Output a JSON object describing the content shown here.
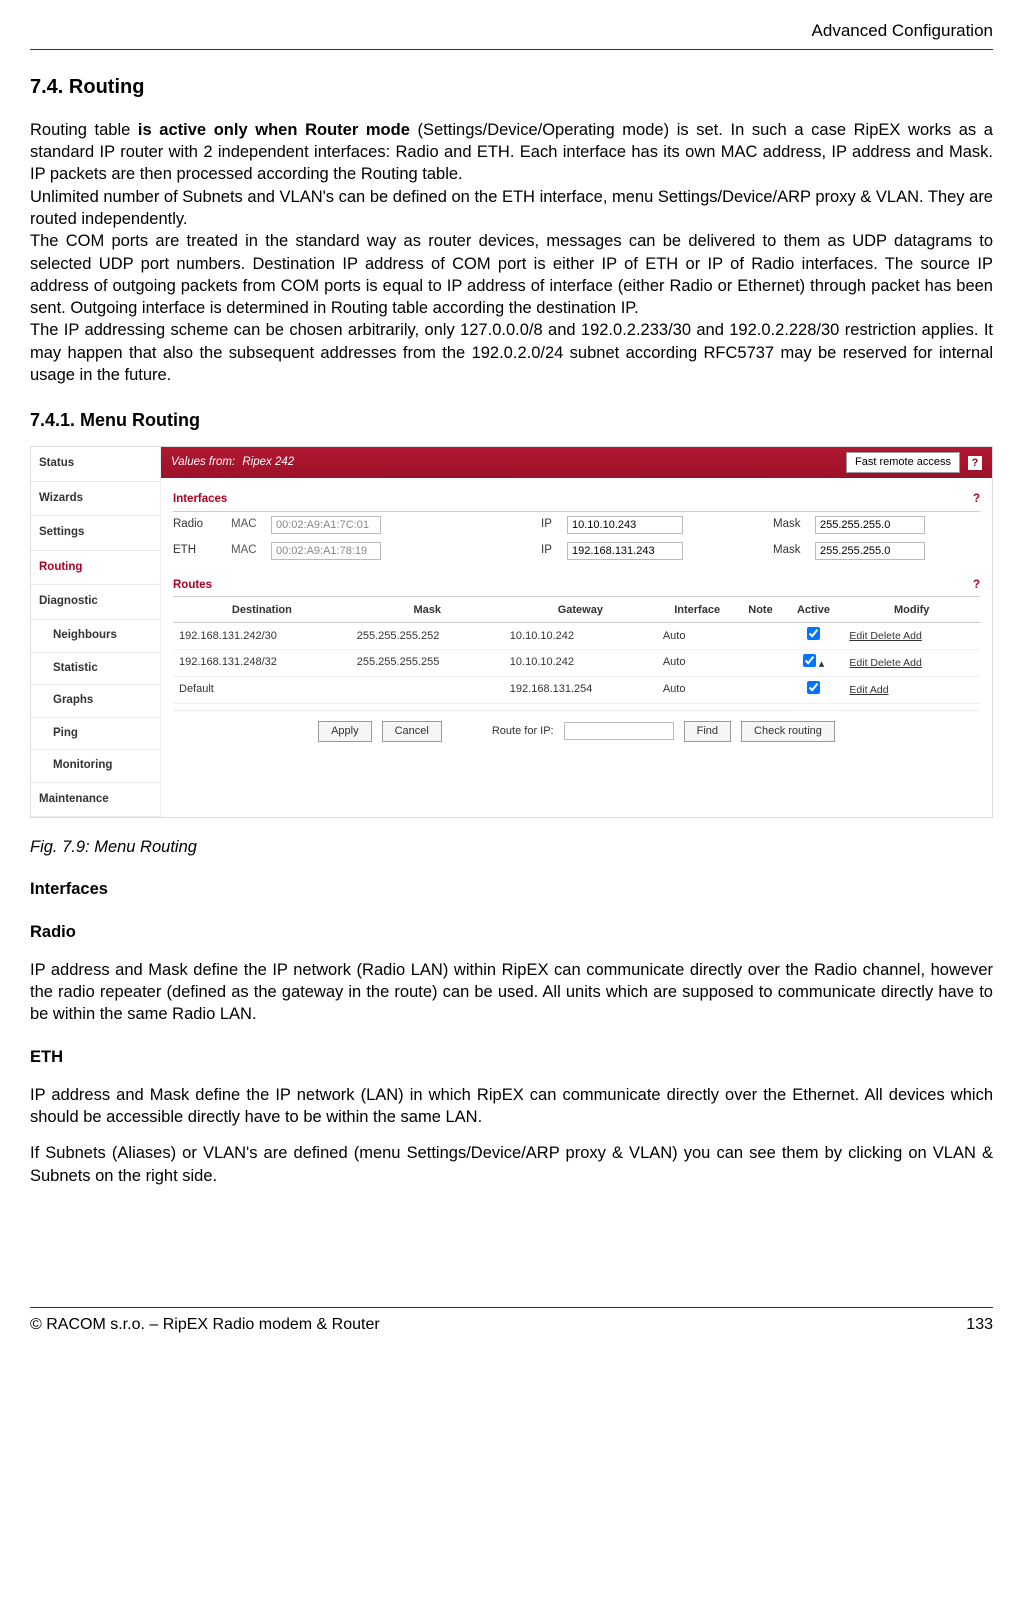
{
  "header": {
    "right": "Advanced Configuration"
  },
  "section": {
    "title": "7.4. Routing",
    "p1a": "Routing table ",
    "p1b": "is active only when Router mode",
    "p1c": " (Settings/Device/Operating mode) is set. In such a case RipEX works as a standard IP router with 2 independent interfaces: Radio and ETH. Each interface has its own MAC address, IP address and Mask. IP packets are then processed according the Routing table.",
    "p2": "Unlimited number of Subnets and VLAN's can be defined on the ETH interface, menu Settings/Device/ARP proxy & VLAN. They are routed independently.",
    "p3": "The COM ports are treated in the standard way as router devices, messages can be delivered to them as UDP datagrams to selected UDP port numbers. Destination IP address of COM port is either IP of ETH or IP of Radio interfaces. The source IP address of outgoing packets from COM ports is equal to IP address of interface (either Radio or Ethernet) through packet has been sent. Outgoing interface is determined in Routing table according the destination IP.",
    "p4": "The IP addressing scheme can be chosen arbitrarily, only 127.0.0.0/8 and 192.0.2.233/30 and 192.0.2.228/30 restriction applies. It may happen that also the subsequent addresses from the 192.0.2.0/24 subnet according RFC5737 may be reserved for internal usage in the future.",
    "subTitle": "7.4.1. Menu Routing"
  },
  "screenshot": {
    "sidebar": {
      "items": [
        "Status",
        "Wizards",
        "Settings",
        "Routing",
        "Diagnostic"
      ],
      "subitems": [
        "Neighbours",
        "Statistic",
        "Graphs",
        "Ping",
        "Monitoring"
      ],
      "last": "Maintenance",
      "activeIndex": 3
    },
    "topbar": {
      "label": "Values from:",
      "device": "Ripex 242",
      "fast": "Fast remote access",
      "help": "?"
    },
    "interfaces": {
      "title": "Interfaces",
      "help": "?",
      "rows": [
        {
          "name": "Radio",
          "macLabel": "MAC",
          "mac": "00:02:A9:A1:7C:01",
          "ipLabel": "IP",
          "ip": "10.10.10.243",
          "maskLabel": "Mask",
          "mask": "255.255.255.0"
        },
        {
          "name": "ETH",
          "macLabel": "MAC",
          "mac": "00:02:A9:A1:78:19",
          "ipLabel": "IP",
          "ip": "192.168.131.243",
          "maskLabel": "Mask",
          "mask": "255.255.255.0"
        }
      ]
    },
    "routes": {
      "title": "Routes",
      "help": "?",
      "headers": [
        "Destination",
        "Mask",
        "Gateway",
        "Interface",
        "Note",
        "Active",
        "Modify"
      ],
      "rows": [
        {
          "dest": "192.168.131.242/30",
          "mask": "255.255.255.252",
          "gw": "10.10.10.242",
          "iface": "Auto",
          "note": "",
          "active": true,
          "arrow": "",
          "mod": "Edit Delete Add"
        },
        {
          "dest": "192.168.131.248/32",
          "mask": "255.255.255.255",
          "gw": "10.10.10.242",
          "iface": "Auto",
          "note": "",
          "active": true,
          "arrow": "▴",
          "mod": "Edit Delete Add"
        },
        {
          "dest": "Default",
          "mask": "",
          "gw": "192.168.131.254",
          "iface": "Auto",
          "note": "",
          "active": true,
          "arrow": "",
          "mod": "Edit          Add"
        }
      ]
    },
    "bottom": {
      "apply": "Apply",
      "cancel": "Cancel",
      "routeFor": "Route for IP:",
      "find": "Find",
      "check": "Check routing"
    }
  },
  "figcaption": "Fig. 7.9: Menu Routing",
  "hInterfaces": "Interfaces",
  "hRadio": "Radio",
  "pRadio": "IP address and Mask define the IP network (Radio LAN) within RipEX can communicate directly over the Radio channel, however the radio repeater (defined as the gateway in the route) can be used. All units which are supposed to communicate directly have to be within the same Radio LAN.",
  "hEth": "ETH",
  "pEth1": "IP address and Mask define the IP network (LAN) in which RipEX can communicate directly over the Ethernet. All devices which should be accessible directly have to be within the same LAN.",
  "pEth2": "If Subnets (Aliases) or VLAN's are defined (menu Settings/Device/ARP proxy & VLAN) you can see them by clicking on VLAN & Subnets on the right side.",
  "footer": {
    "left": "© RACOM s.r.o. – RipEX Radio modem & Router",
    "right": "133"
  }
}
